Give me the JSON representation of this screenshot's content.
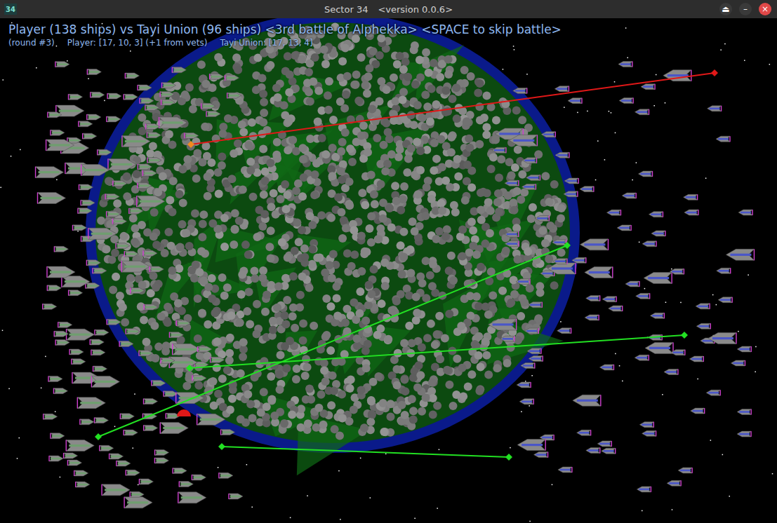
{
  "window": {
    "title": "Sector 34",
    "version": "<version 0.0.6>",
    "icon": "34",
    "controls": [
      {
        "label": "⏏",
        "color": "#3a3a3a"
      },
      {
        "label": "–",
        "color": "#3a3a3a"
      },
      {
        "label": "×",
        "color": "#e04848"
      }
    ]
  },
  "battle": {
    "headline": "Player (138 ships) vs Tayi Union (96 ships) <3rd battle of Alphekka> <SPACE to skip battle>",
    "round": "(round #3)",
    "player_stats": "Player: [17, 10, 3] (+1 from vets)",
    "enemy_stats": "Tayi Union: [17, 13, 4]"
  },
  "fleets": [
    {
      "name": "Player",
      "ships": 138,
      "color": "#6f9e6f",
      "side": "left"
    },
    {
      "name": "Tayi Union",
      "ships": 96,
      "color": "#4a56c8",
      "side": "right"
    }
  ],
  "beams": [
    {
      "color": "#e01818"
    },
    {
      "color": "#22e022"
    },
    {
      "color": "#22e022"
    },
    {
      "color": "#22e022"
    }
  ]
}
